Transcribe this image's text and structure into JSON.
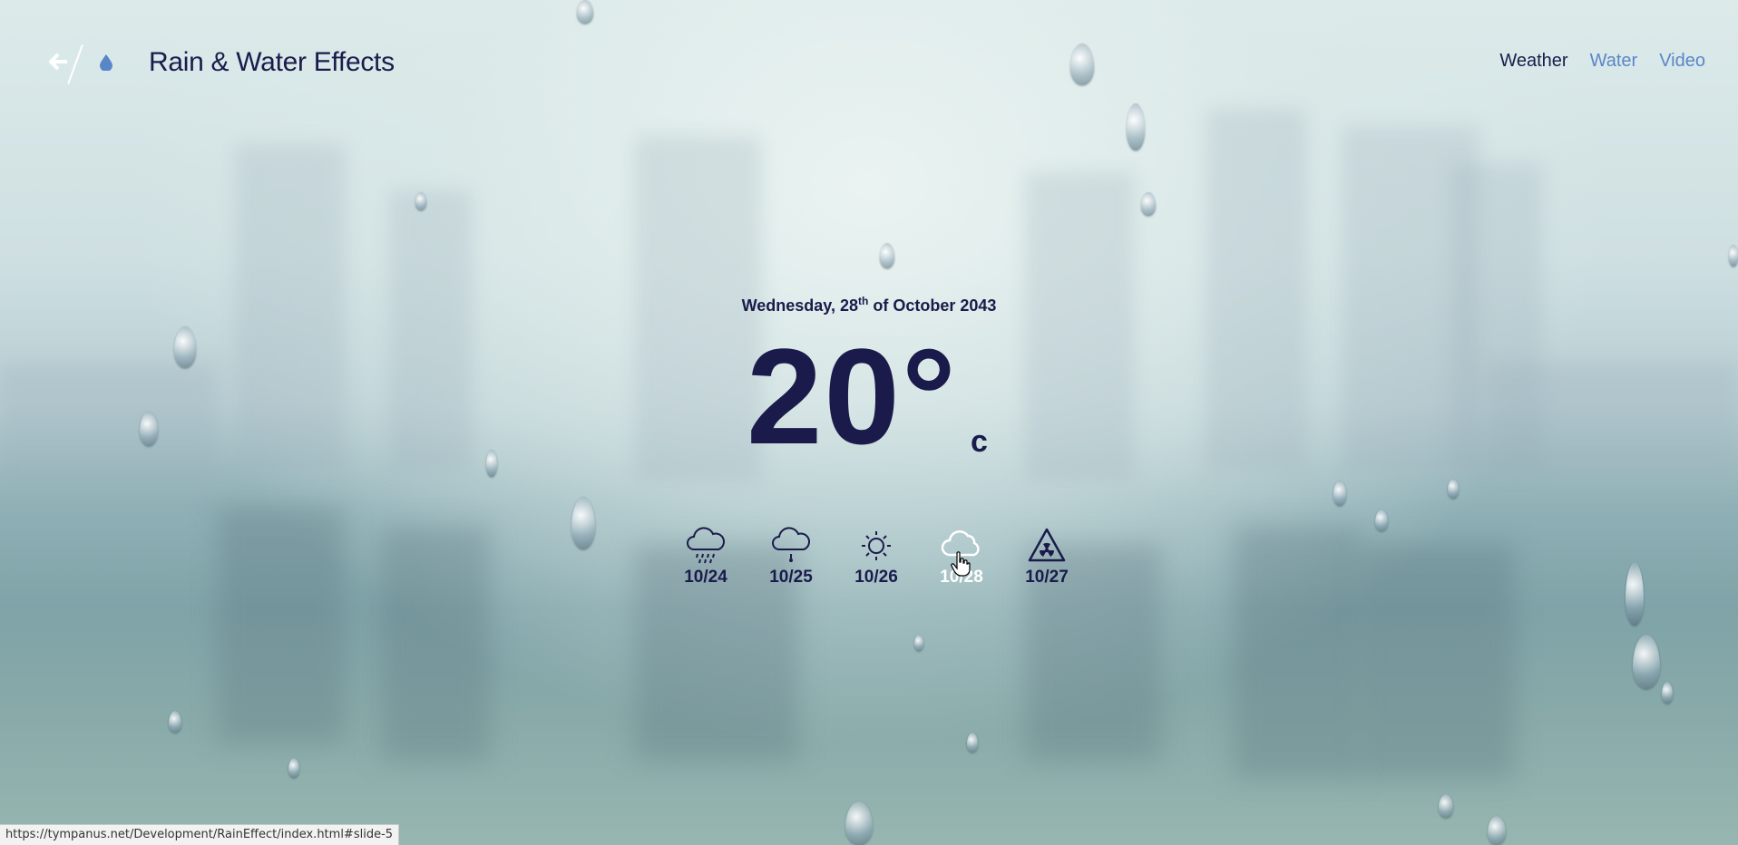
{
  "header": {
    "title": "Rain & Water Effects",
    "back_icon": "arrow-left-icon",
    "logo_icon": "water-drop-icon"
  },
  "nav": {
    "items": [
      {
        "label": "Weather",
        "active": true
      },
      {
        "label": "Water",
        "active": false
      },
      {
        "label": "Video",
        "active": false
      }
    ]
  },
  "weather": {
    "date_prefix": "Wednesday, 28",
    "date_sup": "th",
    "date_suffix": " of October 2043",
    "temperature": "20°",
    "unit": "c"
  },
  "forecast": [
    {
      "date": "10/24",
      "icon": "cloud-rain-heavy-icon"
    },
    {
      "date": "10/25",
      "icon": "cloud-rain-icon"
    },
    {
      "date": "10/26",
      "icon": "sun-icon"
    },
    {
      "date": "10/28",
      "icon": "cloud-icon",
      "selected": true
    },
    {
      "date": "10/27",
      "icon": "radiation-warning-icon"
    }
  ],
  "statusbar": {
    "url": "https://tympanus.net/Development/RainEffect/index.html#slide-5"
  },
  "colors": {
    "text_dark": "#1a1b4b",
    "nav_inactive": "#5a86c9",
    "selected": "#ffffff"
  }
}
